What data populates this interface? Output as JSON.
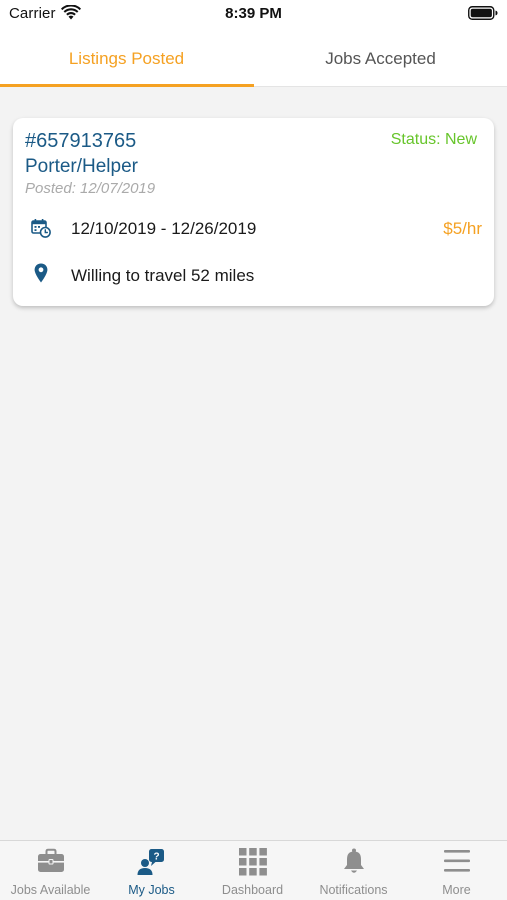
{
  "status_bar": {
    "carrier": "Carrier",
    "time": "8:39 PM",
    "icons": [
      "wifi-icon",
      "battery-icon"
    ]
  },
  "tabs": [
    {
      "label": "Listings Posted",
      "active": true
    },
    {
      "label": "Jobs Accepted",
      "active": false
    }
  ],
  "job": {
    "id": "#657913765",
    "status": "Status: New",
    "title": "Porter/Helper",
    "posted_label": "Posted:",
    "posted_date": "12/07/2019",
    "date_range": "12/10/2019 - 12/26/2019",
    "rate": "$5/hr",
    "travel": "Willing to travel 52 miles",
    "icons": [
      "calendar-clock-icon",
      "map-pin-icon"
    ]
  },
  "tab_bar": [
    {
      "label": "Jobs Available",
      "icon": "briefcase-icon",
      "active": false
    },
    {
      "label": "My Jobs",
      "icon": "worker-question-icon",
      "active": true
    },
    {
      "label": "Dashboard",
      "icon": "grid-icon",
      "active": false
    },
    {
      "label": "Notifications",
      "icon": "bell-icon",
      "active": false
    },
    {
      "label": "More",
      "icon": "menu-icon",
      "active": false
    }
  ],
  "colors": {
    "accent_orange": "#f5a122",
    "primary_blue": "#1b5a86",
    "status_green": "#67c52b",
    "muted_gray": "#aaaaaa",
    "background": "#f3f3f3"
  }
}
